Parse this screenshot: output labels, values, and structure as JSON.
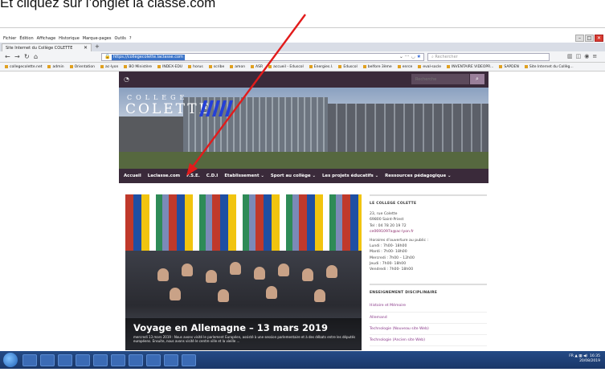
{
  "caption": "Et cliquez sur l’onglet la classe.com",
  "browser": {
    "menu": [
      "Fichier",
      "Édition",
      "Affichage",
      "Historique",
      "Marque-pages",
      "Outils",
      "?"
    ],
    "tab_title": "Site Internet du Collège COLETTE",
    "url": "https://collegecolette.laclasse.com",
    "search_placeholder": "Rechercher",
    "bookmarks": [
      "collegecolette.net",
      "admin",
      "Orientation",
      "ac-lyon",
      "BO Ministère",
      "INDEX-EDU",
      "horus",
      "scribe",
      "amon",
      "ASR",
      "accueil - Eduscol",
      "Energies.l.",
      "Eduscol",
      "belfore 3ème",
      "enrce",
      "eval-socle",
      "INVENTAIRE VIDEOPR...",
      "SAPDEN",
      "Site Internet du Collèg..."
    ]
  },
  "site": {
    "search_placeholder": "Recherche",
    "logo_top": "COLLEGE",
    "logo_name": "COLETTE",
    "nav": [
      "Accueil",
      "Laclasse.com",
      "F.S.E.",
      "C.D.I",
      "Etablissement ⌄",
      "Sport au collège ⌄",
      "Les projets éducatifs ⌄",
      "Ressources pédagogique ⌄"
    ],
    "slide": {
      "title": "Voyage en Allemagne – 13 mars 2019",
      "text": "mercredi 13 mars 2019 : Nous avons visité le parlement Européen, assisté à une session parlementaire et à des débats entre les députés européens. Ensuite, nous avons visité le centre ville et la vieille ..."
    },
    "sidebar": {
      "contact_title": "LE COLLEGE COLETTE",
      "address1": "23, rue Colette",
      "address2": "69800 Saint-Priest",
      "phone": "Tel : 04 78 20 19 72",
      "email": "ce0691097a@ac-lyon.fr",
      "hours_title": "Horaires d’ouverture au public :",
      "hours": [
        "Lundi : 7h00- 18h00",
        "Mardi : 7h00- 18h00",
        "Mercredi : 7h00 – 12h00",
        "Jeudi : 7h00- 18h00",
        "Vendredi : 7h00- 18h00"
      ],
      "teaching_title": "ENSEIGNEMENT DISCIPLINAIRE",
      "links": [
        "Histoire et Mémoire",
        "Allemand",
        "Technologie (Nouveau site Web)",
        "Technologie (Ancien site Web)"
      ]
    }
  },
  "taskbar": {
    "time": "16:35",
    "date": "20/08/2019",
    "lang": "FR"
  },
  "colors": {
    "arrow": "#e21b1b",
    "site_dark": "#3a2a3a",
    "accent": "#8a3a8a"
  }
}
